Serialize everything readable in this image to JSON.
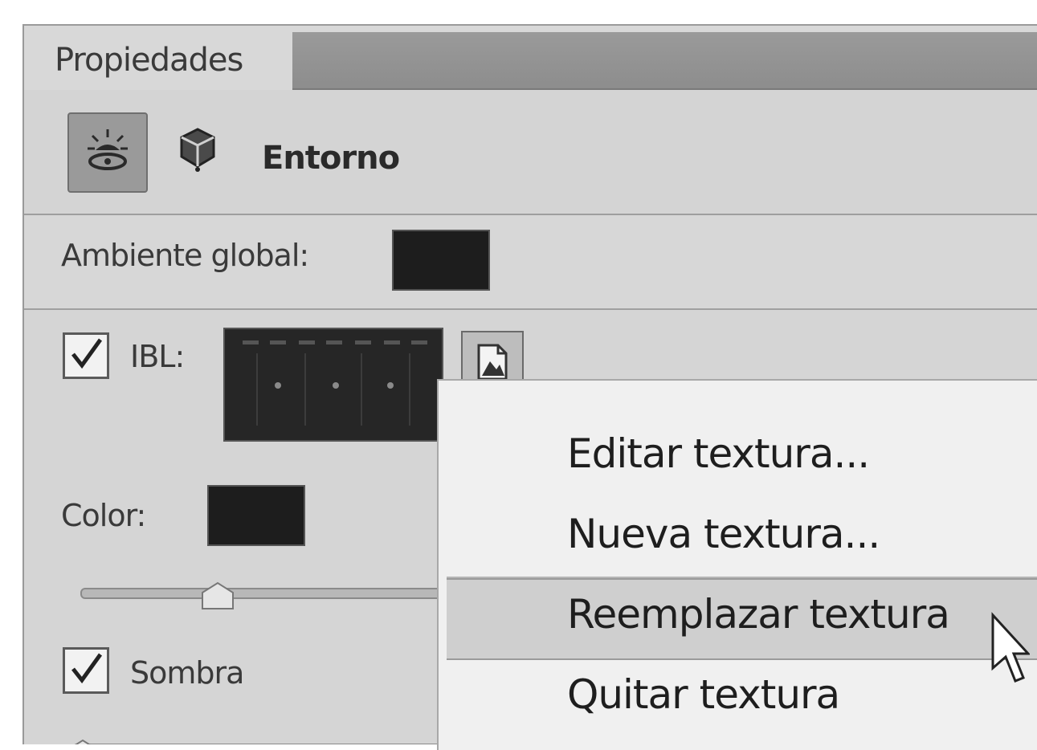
{
  "panel": {
    "tab_label": "Propiedades",
    "environment_label": "Entorno",
    "ambient_label": "Ambiente global:",
    "ibl_label": "IBL:",
    "color_label": "Color:",
    "shadow_label": "Sombra",
    "ibl_checked": true,
    "shadow_checked": true,
    "icons": {
      "light": "light-icon",
      "cube": "cube-icon",
      "texture": "texture-icon",
      "check": "check-icon",
      "cursor": "cursor-icon"
    },
    "colors": {
      "panel_bg": "#d2d2d2",
      "swatch": "#1d1d1d",
      "active_tool": "#9a9a9a",
      "menu_bg": "#f0f0f0",
      "menu_highlight": "#cfcfcf"
    }
  },
  "context_menu": {
    "items": [
      {
        "label": "Editar textura..."
      },
      {
        "label": "Nueva textura..."
      },
      {
        "label": "Reemplazar textura",
        "highlighted": true
      },
      {
        "label": "Quitar textura"
      }
    ]
  }
}
